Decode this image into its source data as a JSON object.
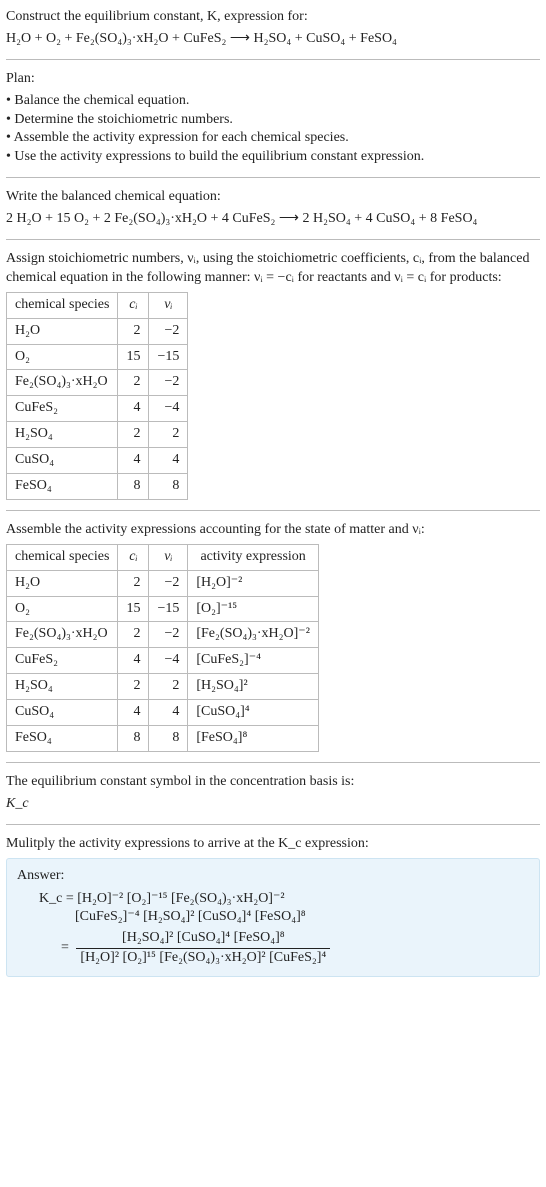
{
  "prompt": {
    "line1": "Construct the equilibrium constant, K, expression for:",
    "eq": "H₂O + O₂ + Fe₂(SO₄)₃·xH₂O + CuFeS₂  ⟶  H₂SO₄ + CuSO₄ + FeSO₄"
  },
  "plan": {
    "heading": "Plan:",
    "items": [
      "• Balance the chemical equation.",
      "• Determine the stoichiometric numbers.",
      "• Assemble the activity expression for each chemical species.",
      "• Use the activity expressions to build the equilibrium constant expression."
    ]
  },
  "balanced": {
    "heading": "Write the balanced chemical equation:",
    "eq": "2 H₂O + 15 O₂ + 2 Fe₂(SO₄)₃·xH₂O + 4 CuFeS₂  ⟶  2 H₂SO₄ + 4 CuSO₄ + 8 FeSO₄"
  },
  "stoich": {
    "heading": "Assign stoichiometric numbers, νᵢ, using the stoichiometric coefficients, cᵢ, from the balanced chemical equation in the following manner: νᵢ = −cᵢ for reactants and νᵢ = cᵢ for products:",
    "headers": [
      "chemical species",
      "cᵢ",
      "νᵢ"
    ],
    "rows": [
      {
        "sp": "H₂O",
        "c": "2",
        "v": "−2"
      },
      {
        "sp": "O₂",
        "c": "15",
        "v": "−15"
      },
      {
        "sp": "Fe₂(SO₄)₃·xH₂O",
        "c": "2",
        "v": "−2"
      },
      {
        "sp": "CuFeS₂",
        "c": "4",
        "v": "−4"
      },
      {
        "sp": "H₂SO₄",
        "c": "2",
        "v": "2"
      },
      {
        "sp": "CuSO₄",
        "c": "4",
        "v": "4"
      },
      {
        "sp": "FeSO₄",
        "c": "8",
        "v": "8"
      }
    ]
  },
  "activity": {
    "heading": "Assemble the activity expressions accounting for the state of matter and νᵢ:",
    "headers": [
      "chemical species",
      "cᵢ",
      "νᵢ",
      "activity expression"
    ],
    "rows": [
      {
        "sp": "H₂O",
        "c": "2",
        "v": "−2",
        "a": "[H₂O]⁻²"
      },
      {
        "sp": "O₂",
        "c": "15",
        "v": "−15",
        "a": "[O₂]⁻¹⁵"
      },
      {
        "sp": "Fe₂(SO₄)₃·xH₂O",
        "c": "2",
        "v": "−2",
        "a": "[Fe₂(SO₄)₃·xH₂O]⁻²"
      },
      {
        "sp": "CuFeS₂",
        "c": "4",
        "v": "−4",
        "a": "[CuFeS₂]⁻⁴"
      },
      {
        "sp": "H₂SO₄",
        "c": "2",
        "v": "2",
        "a": "[H₂SO₄]²"
      },
      {
        "sp": "CuSO₄",
        "c": "4",
        "v": "4",
        "a": "[CuSO₄]⁴"
      },
      {
        "sp": "FeSO₄",
        "c": "8",
        "v": "8",
        "a": "[FeSO₄]⁸"
      }
    ]
  },
  "kcsymbol": {
    "heading": "The equilibrium constant symbol in the concentration basis is:",
    "value": "K_c"
  },
  "multiply": "Mulitply the activity expressions to arrive at the K_c expression:",
  "answer": {
    "label": "Answer:",
    "line1": "K_c = [H₂O]⁻² [O₂]⁻¹⁵ [Fe₂(SO₄)₃·xH₂O]⁻²",
    "line2": "[CuFeS₂]⁻⁴ [H₂SO₄]² [CuSO₄]⁴ [FeSO₄]⁸",
    "frac_num": "[H₂SO₄]² [CuSO₄]⁴ [FeSO₄]⁸",
    "frac_den": "[H₂O]² [O₂]¹⁵ [Fe₂(SO₄)₃·xH₂O]² [CuFeS₂]⁴"
  }
}
